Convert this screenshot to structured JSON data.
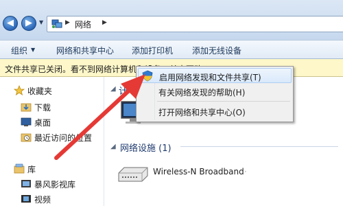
{
  "address_bar": {
    "breadcrumb": "网络",
    "separator": "▶",
    "back_glyph": "◀",
    "forward_glyph": "▶",
    "dropdown_glyph": "▼"
  },
  "toolbar": {
    "organize": "组织",
    "organize_arrow": "▼",
    "network_center": "网络和共享中心",
    "add_printer": "添加打印机",
    "add_wireless": "添加无线设备"
  },
  "info_bar": {
    "text": "文件共享已关闭。看不到网络计算机和设备。单击更改..."
  },
  "nav_pane": {
    "favorites": "收藏夹",
    "downloads": "下载",
    "desktop": "桌面",
    "recent": "最近访问的位置",
    "libraries": "库",
    "storm_video": "暴风影视库",
    "videos": "视频"
  },
  "main": {
    "group_computer_partial": "计",
    "group_arrow": "◢",
    "group_network_infra": "网络设施 (1)",
    "device_label": "Wireless-N Broadband",
    "device_label_tail": "·"
  },
  "context_menu": {
    "items": [
      {
        "label": "启用网络发现和文件共享(T)",
        "icon": "shield-icon"
      },
      {
        "label": "有关网络发现的帮助(H)"
      },
      {
        "label": "打开网络和共享中心(O)"
      }
    ]
  },
  "colors": {
    "annotation_arrow": "#e53935",
    "accent": "#1e395b"
  }
}
